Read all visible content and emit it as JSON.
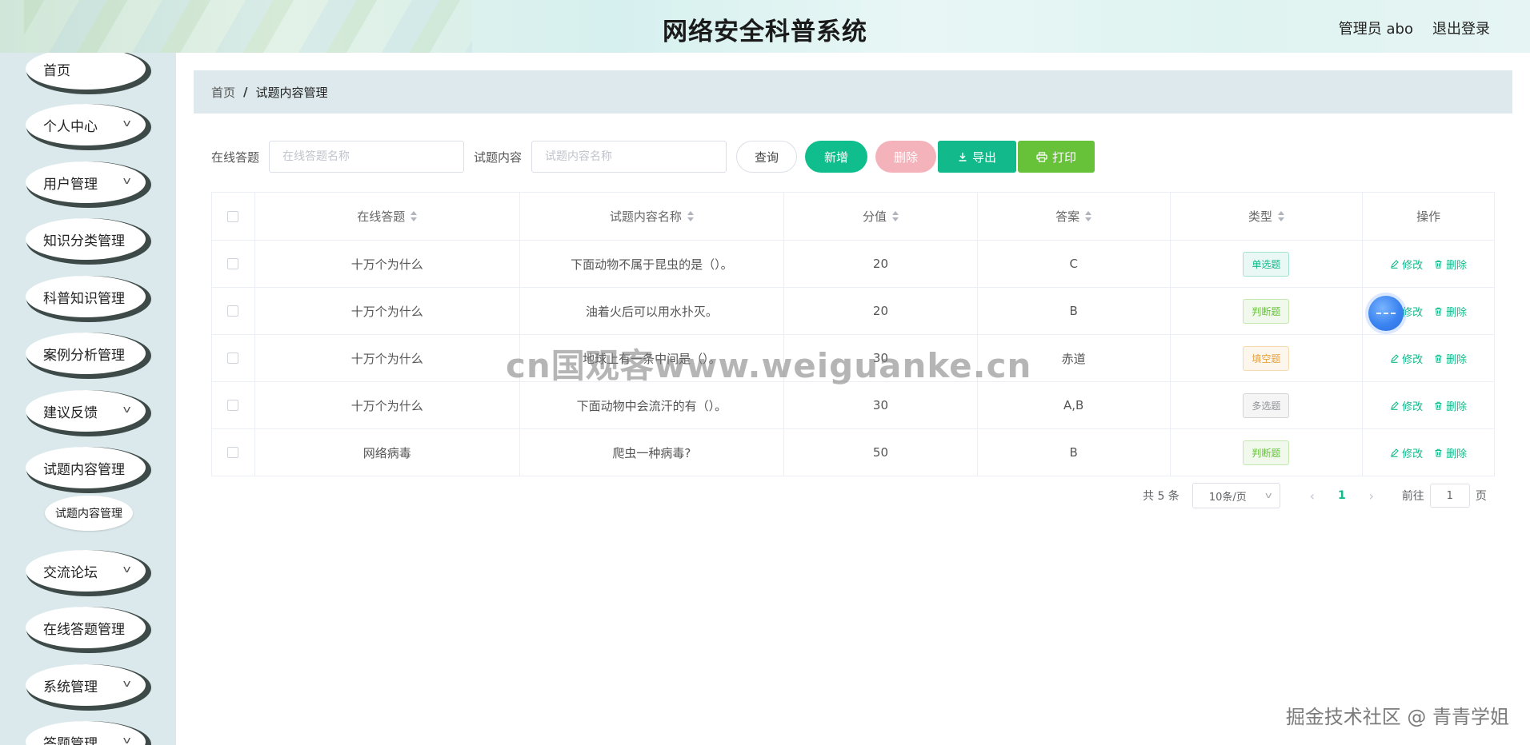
{
  "header": {
    "title": "网络安全科普系统",
    "user": "管理员 abo",
    "logout": "退出登录"
  },
  "sidebar": {
    "items": [
      {
        "label": "首页",
        "has_arrow": false
      },
      {
        "label": "个人中心",
        "has_arrow": true
      },
      {
        "label": "用户管理",
        "has_arrow": true
      },
      {
        "label": "知识分类管理",
        "has_arrow": false
      },
      {
        "label": "科普知识管理",
        "has_arrow": false
      },
      {
        "label": "案例分析管理",
        "has_arrow": false
      },
      {
        "label": "建议反馈",
        "has_arrow": true
      },
      {
        "label": "试题内容管理",
        "has_arrow": false
      },
      {
        "label": "交流论坛",
        "has_arrow": true
      },
      {
        "label": "在线答题管理",
        "has_arrow": false
      },
      {
        "label": "系统管理",
        "has_arrow": true
      },
      {
        "label": "答题管理",
        "has_arrow": true
      }
    ],
    "sub_item": "试题内容管理"
  },
  "breadcrumb": {
    "home": "首页",
    "separator": "/",
    "current": "试题内容管理"
  },
  "search": {
    "label1": "在线答题",
    "placeholder1": "在线答题名称",
    "label2": "试题内容",
    "placeholder2": "试题内容名称",
    "query_btn": "查询",
    "add_btn": "新增",
    "delete_btn": "删除",
    "export_btn": "导出",
    "print_btn": "打印"
  },
  "table": {
    "columns": [
      "在线答题",
      "试题内容名称",
      "分值",
      "答案",
      "类型",
      "操作"
    ],
    "rows": [
      {
        "quiz": "十万个为什么",
        "question": "下面动物不属于昆虫的是（）。",
        "score": "20",
        "answer": "C",
        "type": "单选题",
        "type_color": "#12b98a"
      },
      {
        "quiz": "十万个为什么",
        "question": "油着火后可以用水扑灭。",
        "score": "20",
        "answer": "B",
        "type": "判断题",
        "type_color": "#67c23a"
      },
      {
        "quiz": "十万个为什么",
        "question": "地球上有一条中间是（）。",
        "score": "30",
        "answer": "赤道",
        "type": "填空题",
        "type_color": "#e6a23c"
      },
      {
        "quiz": "十万个为什么",
        "question": "下面动物中会流汗的有（）。",
        "score": "30",
        "answer": "A,B",
        "type": "多选题",
        "type_color": "#909399"
      },
      {
        "quiz": "网络病毒",
        "question": "爬虫一种病毒?",
        "score": "50",
        "answer": "B",
        "type": "判断题",
        "type_color": "#67c23a"
      }
    ],
    "edit_label": "修改",
    "delete_label": "删除"
  },
  "pagination": {
    "total": "共 5 条",
    "page_size": "10条/页",
    "current_page": "1",
    "goto_label": "前往",
    "goto_value": "1",
    "page_unit": "页"
  },
  "watermark": "cn国观客www.weiguanke.cn",
  "corner_watermark": "掘金技术社区 @ 青青学姐",
  "colors": {
    "primary": "#12b98a",
    "danger_light": "#f4b3ba",
    "success": "#67c23a",
    "sidebar_bg": "#dbe9ec"
  }
}
